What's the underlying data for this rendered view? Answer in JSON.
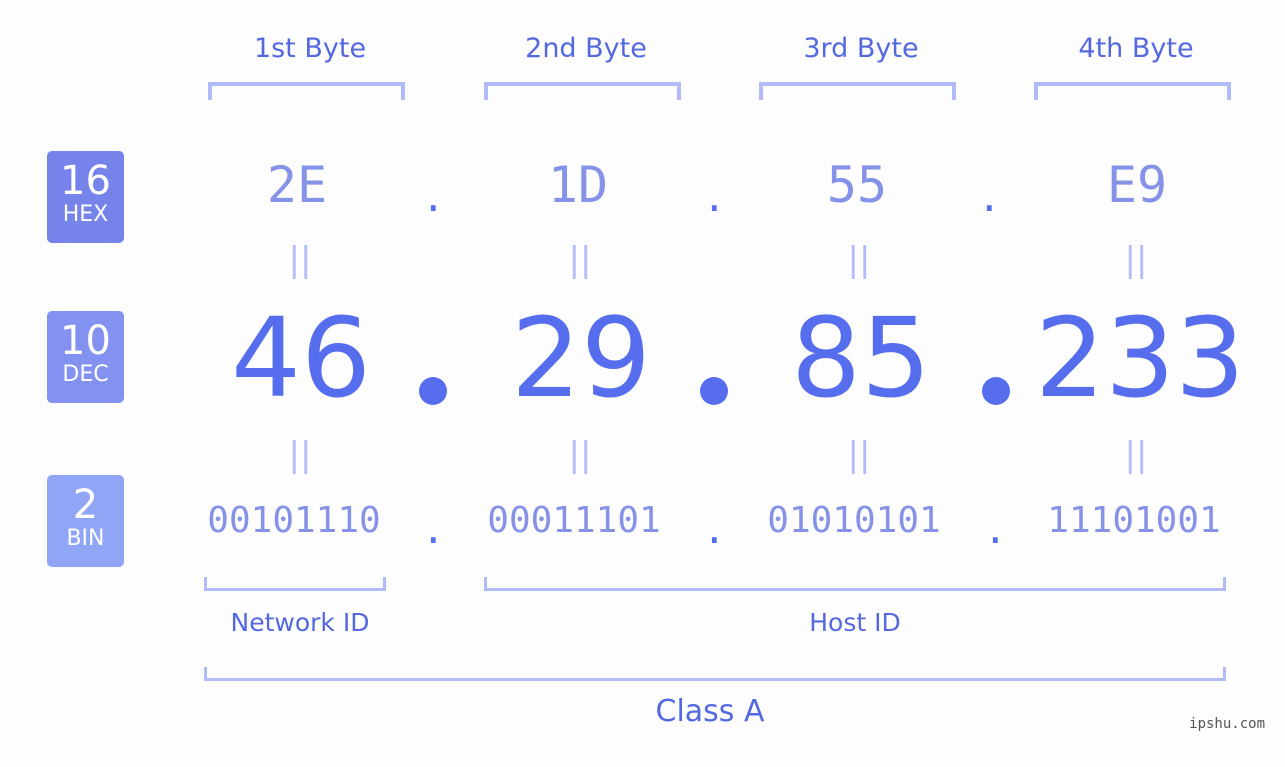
{
  "bases": [
    {
      "number": "16",
      "label": "HEX",
      "color": "#7583eb"
    },
    {
      "number": "10",
      "label": "DEC",
      "color": "#8392f0"
    },
    {
      "number": "2",
      "label": "BIN",
      "color": "#91a5f7"
    }
  ],
  "bytes": [
    {
      "header": "1st Byte",
      "hex": "2E",
      "dec": "46",
      "bin": "00101110"
    },
    {
      "header": "2nd Byte",
      "hex": "1D",
      "dec": "29",
      "bin": "00011101"
    },
    {
      "header": "3rd Byte",
      "hex": "55",
      "dec": "85",
      "bin": "01010101"
    },
    {
      "header": "4th Byte",
      "hex": "E9",
      "dec": "233",
      "bin": "11101001"
    }
  ],
  "separator": ".",
  "equals": "||",
  "network_label": "Network ID",
  "host_label": "Host ID",
  "class_label": "Class A",
  "watermark": "ipshu.com"
}
